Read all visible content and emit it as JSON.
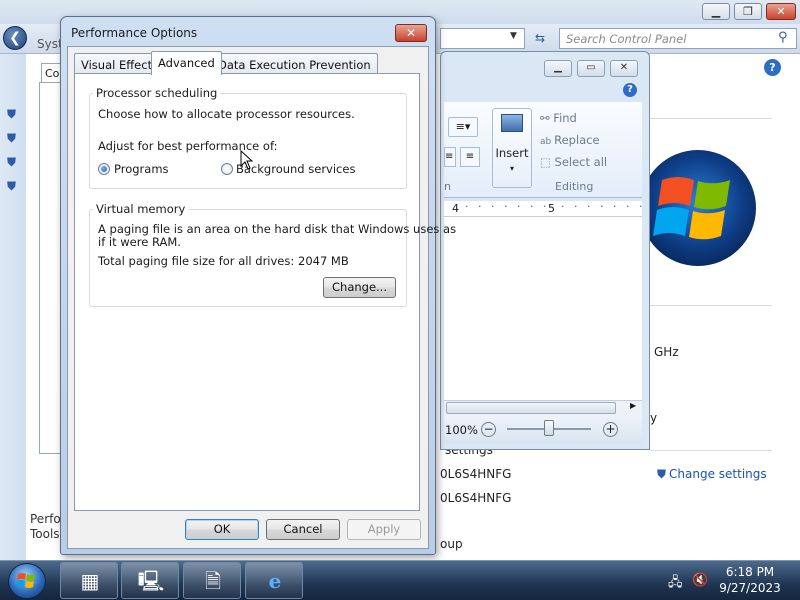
{
  "background_window": {
    "title_fragment": "Syst",
    "tab_fragment": "Co",
    "search_placeholder": "Search Control Panel",
    "left_bottom_text_1": "Perfo",
    "left_bottom_text_2": "Tools",
    "ghz_text": "GHz",
    "y_fragment": "y",
    "settings_fragment": "settings",
    "product_id_1": "0L6S4HNFG",
    "product_id_2": "0L6S4HNFG",
    "workgroup_fragment": "oup",
    "change_settings_label": "Change settings"
  },
  "wordpad": {
    "ribbon": {
      "find_label": "Find",
      "replace_label": "Replace",
      "select_all_label": "Select all",
      "editing_group_label": "Editing",
      "insert_label": "Insert",
      "partial_group_label": "n"
    },
    "ruler": {
      "mark_4": "4",
      "mark_5": "5"
    },
    "zoom_label": "100%",
    "zoom_level": 0.5
  },
  "dialog": {
    "title": "Performance Options",
    "close_label": "✕",
    "tabs": [
      {
        "label": "Visual Effects"
      },
      {
        "label": "Advanced"
      },
      {
        "label": "Data Execution Prevention"
      }
    ],
    "processor": {
      "group_label": "Processor scheduling",
      "description": "Choose how to allocate processor resources.",
      "adjust_label": "Adjust for best performance of:",
      "option_programs": "Programs",
      "option_background": "Background services",
      "selected": "Programs"
    },
    "virtual_memory": {
      "group_label": "Virtual memory",
      "description_line1": "A paging file is an area on the hard disk that Windows uses as",
      "description_line2": "if it were RAM.",
      "total_label": "Total paging file size for all drives:",
      "total_value": "2047 MB",
      "change_button": "Change..."
    },
    "buttons": {
      "ok": "OK",
      "cancel": "Cancel",
      "apply": "Apply"
    }
  },
  "taskbar": {
    "time": "6:18 PM",
    "date": "9/27/2023"
  }
}
